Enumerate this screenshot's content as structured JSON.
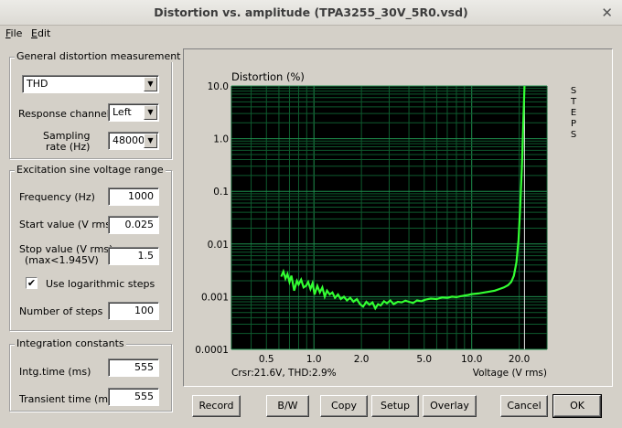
{
  "window": {
    "title": "Distortion vs. amplitude (TPA3255_30V_5R0.vsd)",
    "close_glyph": "✕"
  },
  "menu": {
    "file": "File",
    "edit": "Edit"
  },
  "general": {
    "title": "General distortion measurement",
    "measure_value": "THD",
    "channel_label": "Response channel",
    "channel_value": "Left",
    "rate_label_1": "Sampling",
    "rate_label_2": "rate (Hz)",
    "rate_value": "48000"
  },
  "excitation": {
    "title": "Excitation sine voltage range",
    "freq_label": "Frequency (Hz)",
    "freq_value": "1000",
    "start_label": "Start value (V rms)",
    "start_value": "0.025",
    "stop_label_1": "Stop value (V rms)",
    "stop_label_2": "(max<1.945V)",
    "stop_value": "1.5",
    "log_label": "Use logarithmic steps",
    "log_checked": "✔",
    "steps_label": "Number of steps",
    "steps_value": "100"
  },
  "integration": {
    "title": "Integration constants",
    "intg_label": "Intg.time (ms)",
    "intg_value": "555",
    "transient_label": "Transient time (ms)",
    "transient_value": "555"
  },
  "buttons": {
    "record": "Record",
    "bw": "B/W",
    "copy": "Copy",
    "setup": "Setup",
    "overlay": "Overlay",
    "cancel": "Cancel",
    "ok": "OK"
  },
  "chart_data": {
    "type": "line",
    "title": "Distortion (%)",
    "xlabel": "Voltage (V rms)",
    "cursor_text": "Crsr:21.6V, THD:2.9%",
    "side_label": "STEPS",
    "x_scale": "log",
    "y_scale": "log",
    "xlim": [
      0.3,
      30
    ],
    "ylim": [
      0.0001,
      10
    ],
    "x_ticks": [
      {
        "v": 0.5,
        "label": "0.5"
      },
      {
        "v": 1,
        "label": "1.0"
      },
      {
        "v": 2,
        "label": "2.0"
      },
      {
        "v": 5,
        "label": "5.0"
      },
      {
        "v": 10,
        "label": "10.0"
      },
      {
        "v": 20,
        "label": "20.0"
      }
    ],
    "y_ticks": [
      {
        "v": 10,
        "label": "10.0"
      },
      {
        "v": 1,
        "label": "1.0"
      },
      {
        "v": 0.1,
        "label": "0.1"
      },
      {
        "v": 0.01,
        "label": "0.01"
      },
      {
        "v": 0.001,
        "label": "0.001"
      },
      {
        "v": 0.0001,
        "label": "0.0001"
      }
    ],
    "grid": true,
    "cursor_x": 21.6,
    "series": [
      {
        "color": "#33ff33",
        "x": [
          0.62,
          0.64,
          0.66,
          0.68,
          0.7,
          0.72,
          0.75,
          0.78,
          0.8,
          0.83,
          0.86,
          0.89,
          0.92,
          0.95,
          0.98,
          1.01,
          1.05,
          1.09,
          1.13,
          1.17,
          1.21,
          1.26,
          1.31,
          1.36,
          1.42,
          1.48,
          1.55,
          1.62,
          1.7,
          1.78,
          1.87,
          1.96,
          2.05,
          2.15,
          2.25,
          2.35,
          2.45,
          2.55,
          2.65,
          2.78,
          2.9,
          3.05,
          3.2,
          3.4,
          3.6,
          3.8,
          4.0,
          4.25,
          4.5,
          4.8,
          5.1,
          5.5,
          6.0,
          6.5,
          7.0,
          7.5,
          8.0,
          8.5,
          9.0,
          9.5,
          10.0,
          11.0,
          12.0,
          13.0,
          14.0,
          15.0,
          16.0,
          17.0,
          17.8,
          18.5,
          19.2,
          19.8,
          20.3,
          20.8,
          21.2,
          21.5,
          21.6
        ],
        "y": [
          0.0024,
          0.003,
          0.0022,
          0.0027,
          0.0019,
          0.0025,
          0.0013,
          0.002,
          0.0017,
          0.0021,
          0.0015,
          0.0016,
          0.0019,
          0.0014,
          0.0018,
          0.0011,
          0.0016,
          0.0012,
          0.0015,
          0.001,
          0.0013,
          0.0011,
          0.0012,
          0.00095,
          0.0011,
          0.0009,
          0.001,
          0.00085,
          0.00095,
          0.0008,
          0.0009,
          0.00072,
          0.00065,
          0.0008,
          0.0007,
          0.00078,
          0.0006,
          0.00072,
          0.00068,
          0.00082,
          0.00075,
          0.00085,
          0.00072,
          0.0008,
          0.00078,
          0.00084,
          0.0008,
          0.00076,
          0.00085,
          0.00082,
          0.00088,
          0.00092,
          0.0009,
          0.00097,
          0.00095,
          0.001,
          0.00098,
          0.00102,
          0.00105,
          0.00108,
          0.00112,
          0.00115,
          0.0012,
          0.00125,
          0.0013,
          0.0014,
          0.0015,
          0.00165,
          0.0019,
          0.0025,
          0.0045,
          0.012,
          0.05,
          0.3,
          1.8,
          6.0,
          10.0
        ]
      }
    ]
  }
}
